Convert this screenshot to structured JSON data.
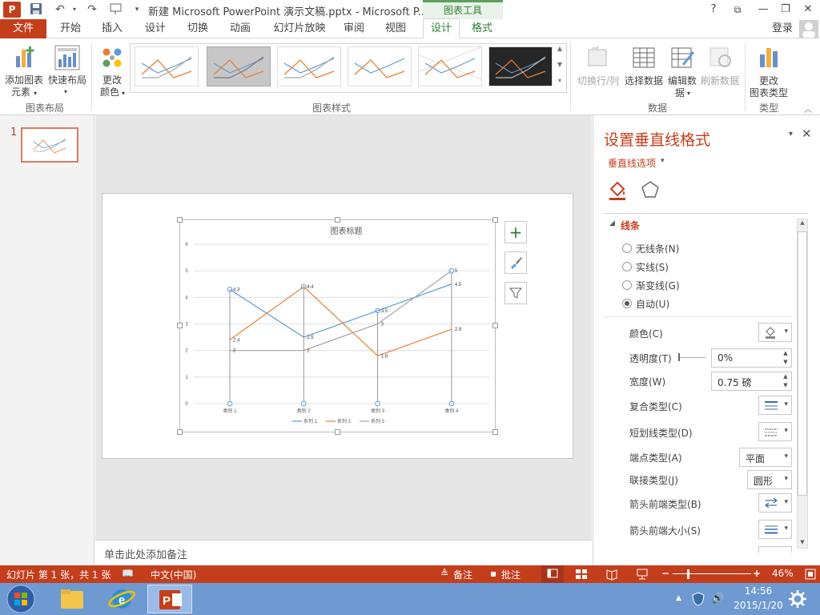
{
  "window": {
    "title": "新建 Microsoft PowerPoint 演示文稿.pptx - Microsoft P...",
    "app_icon": "P",
    "chart_tools_label": "图表工具",
    "help_icon": "?",
    "restore_icon": "⧉",
    "minimize_icon": "—",
    "maximize_icon": "❐",
    "close_icon": "✕"
  },
  "tabs": {
    "file": "文件",
    "home": "开始",
    "insert": "插入",
    "design": "设计",
    "transitions": "切换",
    "animations": "动画",
    "slideshow": "幻灯片放映",
    "review": "审阅",
    "view": "视图",
    "chart_design": "设计",
    "chart_format": "格式",
    "signin": "登录"
  },
  "ribbon": {
    "add_element_1": "添加图表",
    "add_element_2": "元素",
    "quick_layout": "快速布局",
    "change_color_1": "更改",
    "change_color_2": "颜色",
    "group_layouts": "图表布局",
    "group_styles": "图表样式",
    "switch_row_col": "切换行/列",
    "select_data": "选择数据",
    "edit_data_1": "编辑数",
    "edit_data_2": "据",
    "refresh_data": "刷新数据",
    "group_data": "数据",
    "change_type_1": "更改",
    "change_type_2": "图表类型",
    "group_type": "类型"
  },
  "slides": {
    "number": "1"
  },
  "notes_placeholder": "单击此处添加备注",
  "chart_data": {
    "type": "line",
    "title": "图表标题",
    "categories": [
      "类别 1",
      "类别 2",
      "类别 3",
      "类别 4"
    ],
    "series": [
      {
        "name": "系列 1",
        "values": [
          4.3,
          2.5,
          3.5,
          4.5
        ],
        "color": "#5b9bd5"
      },
      {
        "name": "系列 2",
        "values": [
          2.4,
          4.4,
          1.8,
          2.8
        ],
        "color": "#ed7d31"
      },
      {
        "name": "系列 3",
        "values": [
          2,
          2,
          3,
          5
        ],
        "color": "#a5a5a5"
      }
    ],
    "drop_line_top_labels": [
      "4.3",
      "4.4",
      "3.5",
      "5"
    ],
    "ylim": [
      0,
      6
    ],
    "yticks": [
      0,
      1,
      2,
      3,
      4,
      5,
      6
    ],
    "grid": true,
    "legend": "bottom",
    "drop_lines": true
  },
  "pane": {
    "title": "设置垂直线格式",
    "options_label": "垂直线选项",
    "section": "线条",
    "radios": [
      "无线条(N)",
      "实线(S)",
      "渐变线(G)",
      "自动(U)"
    ],
    "selected_radio": 3,
    "color_label": "颜色(C)",
    "transparency_label": "透明度(T)",
    "transparency_value": "0%",
    "width_label": "宽度(W)",
    "width_value": "0.75 磅",
    "compound_label": "复合类型(C)",
    "dash_label": "短划线类型(D)",
    "cap_label": "端点类型(A)",
    "cap_value": "平面",
    "join_label": "联接类型(J)",
    "join_value": "圆形",
    "arrow_begin_type_label": "箭头前端类型(B)",
    "arrow_begin_size_label": "箭头前端大小(S)"
  },
  "status": {
    "slide_info": "幻灯片 第 1 张，共 1 张",
    "language": "中文(中国)",
    "notes": "备注",
    "comments": "批注",
    "zoom": "46%"
  },
  "taskbar": {
    "time": "14:56",
    "date": "2015/1/20"
  }
}
